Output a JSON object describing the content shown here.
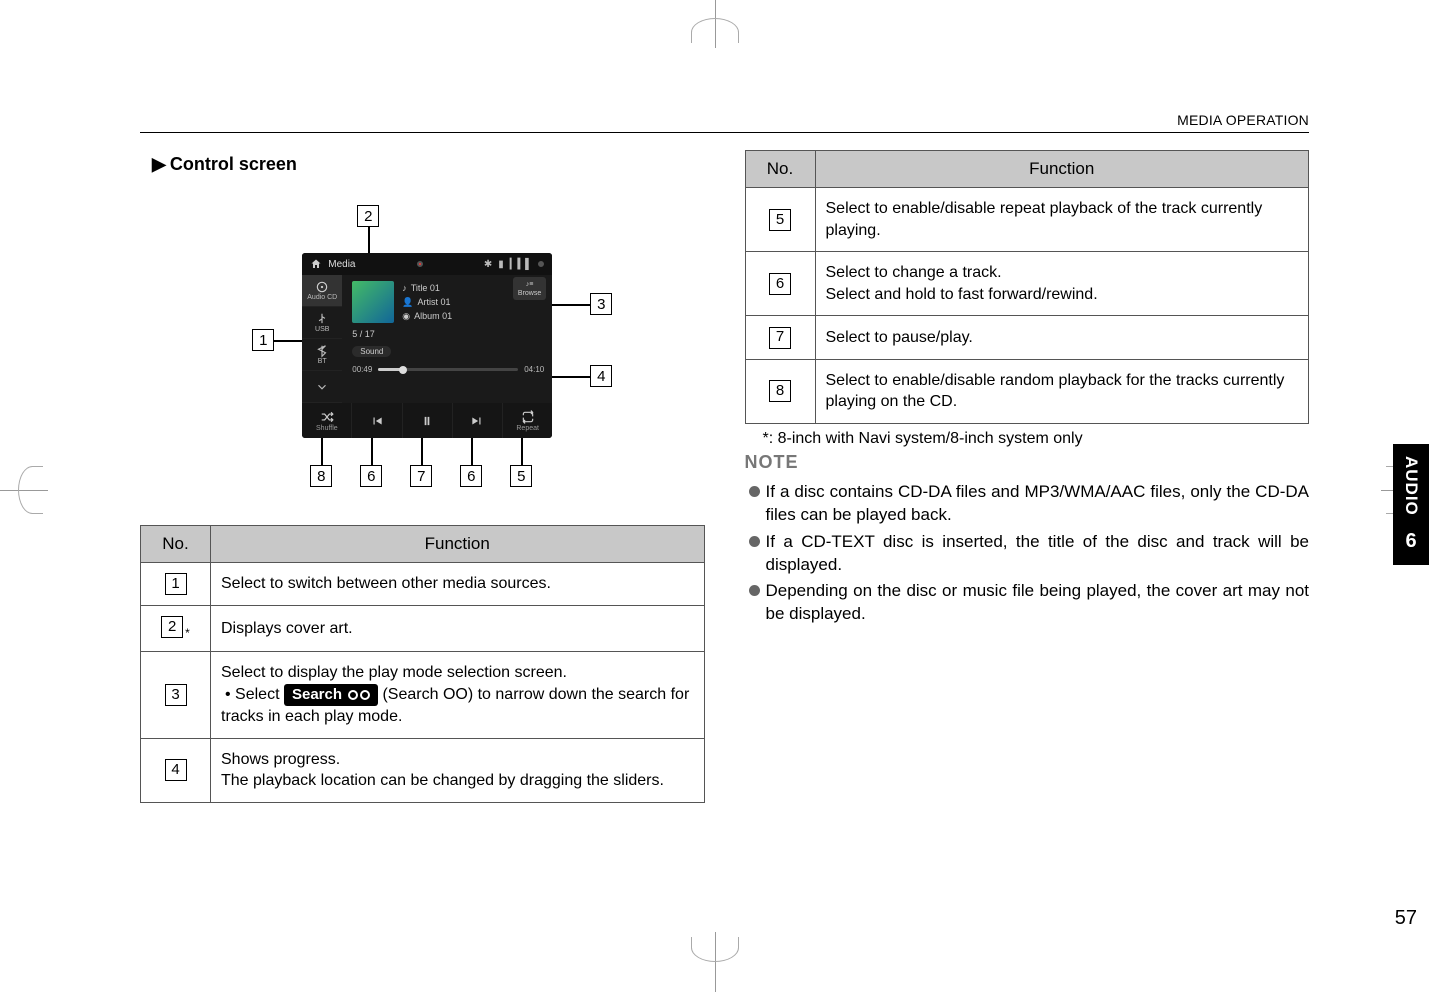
{
  "header": {
    "section_title": "MEDIA OPERATION"
  },
  "section": {
    "control_screen_label": "Control screen",
    "arrow": "▶"
  },
  "screenshot": {
    "topbar": {
      "title": "Media"
    },
    "sources": {
      "audio_cd": "Audio CD",
      "usb": "USB",
      "bt": "BT"
    },
    "browse": {
      "label": "Browse"
    },
    "meta": {
      "title": "Title 01",
      "artist": "Artist 01",
      "album": "Album 01"
    },
    "track_index": "5 / 17",
    "sound_chip": "Sound",
    "time": {
      "elapsed": "00:49",
      "total": "04:10"
    },
    "controls": {
      "shuffle": "Shuffle",
      "repeat": "Repeat"
    }
  },
  "callouts": {
    "c1": "1",
    "c2": "2",
    "c3": "3",
    "c4": "4",
    "c5": "5",
    "c6": "6",
    "c7": "7",
    "c8": "8"
  },
  "table_left": {
    "head_no": "No.",
    "head_fn": "Function",
    "rows": [
      {
        "n": "1",
        "text": "Select to switch between other media sources."
      },
      {
        "n": "2",
        "text": "Displays cover art.",
        "asterisk": "*"
      },
      {
        "n": "3",
        "pre": "Select to display the play mode selection screen.",
        "bullet": "• Select ",
        "chip": "Search",
        "mid": " (Search OO) to narrow down the search for tracks in each play mode."
      },
      {
        "n": "4",
        "text_a": "Shows progress.",
        "text_b": "The playback location can be changed by dragging the sliders."
      }
    ]
  },
  "table_right": {
    "head_no": "No.",
    "head_fn": "Function",
    "rows": [
      {
        "n": "5",
        "text": "Select to enable/disable repeat playback of the track currently playing."
      },
      {
        "n": "6",
        "text_a": "Select to change a track.",
        "text_b": "Select and hold to fast forward/rewind."
      },
      {
        "n": "7",
        "text": "Select to pause/play."
      },
      {
        "n": "8",
        "text": "Select to enable/disable random playback for the tracks currently playing on the CD."
      }
    ]
  },
  "footnote": "*: 8-inch with Navi system/8-inch system only",
  "note": {
    "title": "NOTE",
    "items": [
      "If a disc contains CD-DA files and MP3/WMA/AAC files, only the CD-DA files can be played back.",
      "If a CD-TEXT disc is inserted, the title of the disc and track will be displayed.",
      "Depending on the disc or music file being played, the cover art may not be displayed."
    ]
  },
  "side_tab": {
    "label": "AUDIO",
    "chapter": "6"
  },
  "page_number": "57"
}
